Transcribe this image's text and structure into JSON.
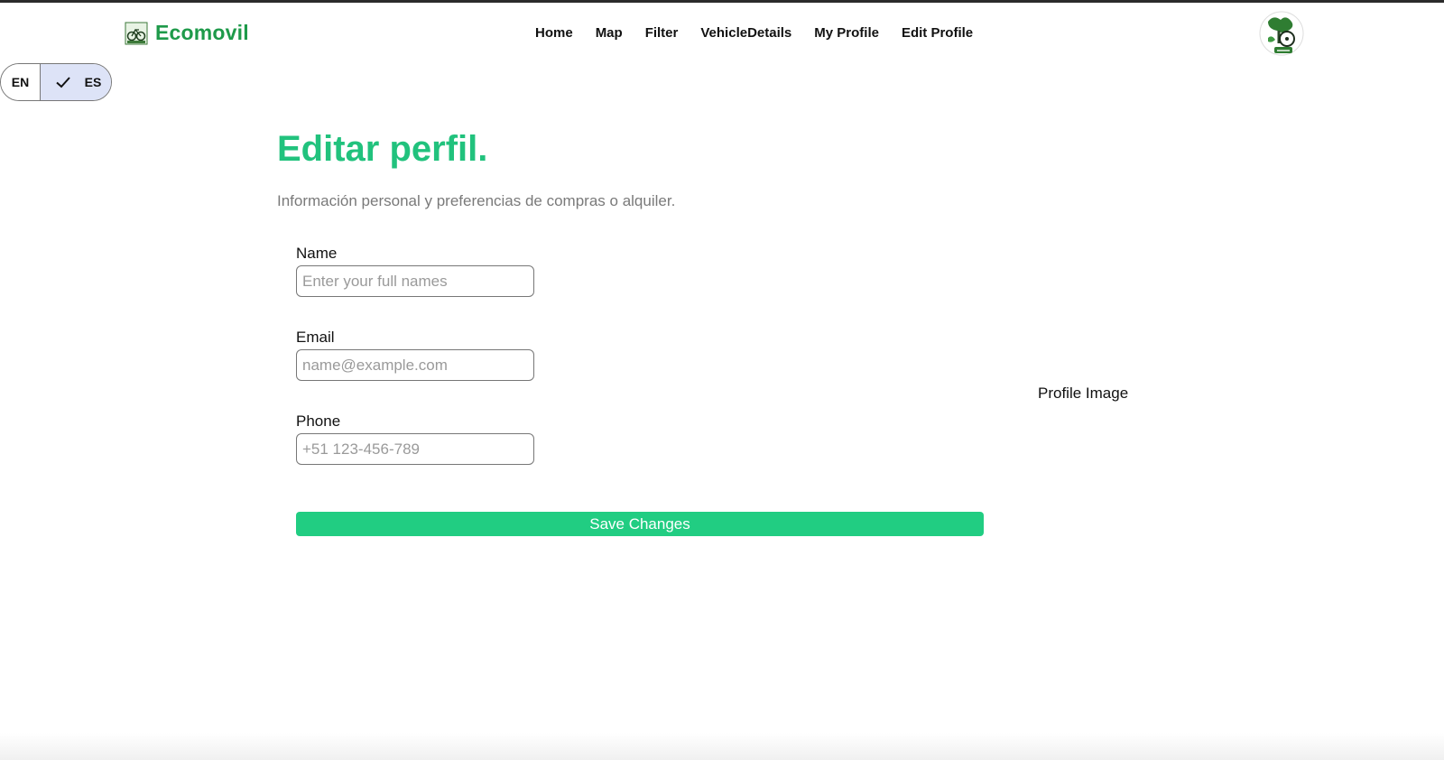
{
  "header": {
    "brand_name": "Ecomovil",
    "nav": [
      "Home",
      "Map",
      "Filter",
      "VehicleDetails",
      "My Profile",
      "Edit Profile"
    ]
  },
  "language": {
    "options": [
      "EN",
      "ES"
    ],
    "selected": "ES"
  },
  "main": {
    "title": "Editar perfil.",
    "subtitle": "Información personal y preferencias de compras o alquiler.",
    "fields": {
      "name": {
        "label": "Name",
        "placeholder": "Enter your full names",
        "value": ""
      },
      "email": {
        "label": "Email",
        "placeholder": "name@example.com",
        "value": ""
      },
      "phone": {
        "label": "Phone",
        "placeholder": "+51 123-456-789",
        "value": ""
      }
    },
    "save_label": "Save Changes",
    "profile_image_label": "Profile Image"
  },
  "colors": {
    "brand_green": "#1e9a4a",
    "accent_green": "#21c27d",
    "button_green": "#21cd82",
    "lang_selected_bg": "#dde3f7"
  },
  "icons": {
    "brand_logo": "bike-logo-icon",
    "avatar": "bike-avatar",
    "check": "check-icon"
  }
}
